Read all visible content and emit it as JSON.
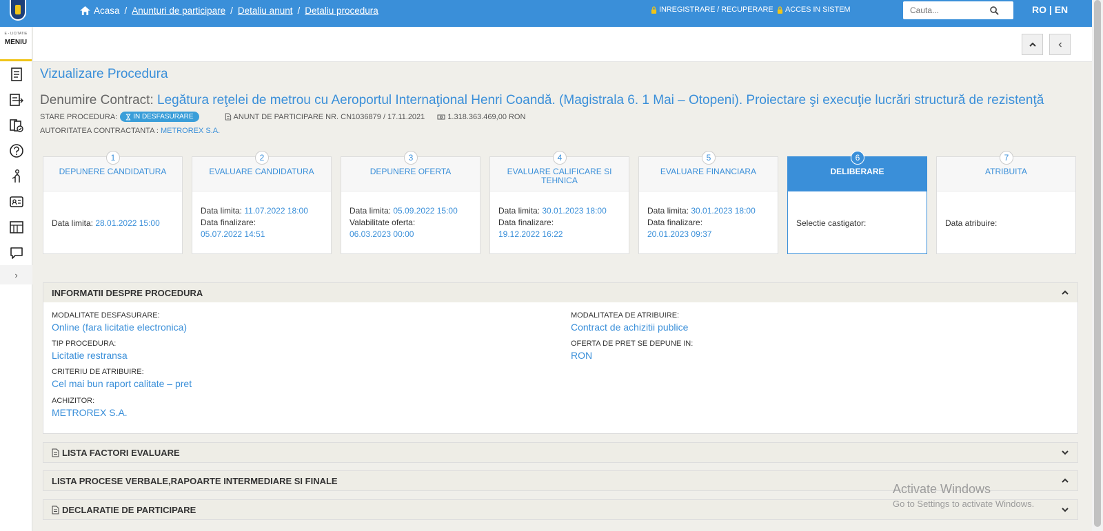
{
  "topbar": {
    "breadcrumbs": [
      "Acasa",
      "Anunturi de participare",
      "Detaliu anunt",
      "Detaliu procedura"
    ],
    "register_label": "INREGISTRARE / RECUPERARE",
    "login_label": "ACCES IN SISTEM",
    "search_placeholder": "Cauta...",
    "language": "RO | EN"
  },
  "sidebar": {
    "brand_small": "E - LICITATIE",
    "menu_label": "MENIU",
    "items": [
      "procedures-icon",
      "export-icon",
      "documents-check-icon",
      "help-icon",
      "user-handshake-icon",
      "id-card-icon",
      "catalog-icon",
      "chat-icon"
    ]
  },
  "header": {
    "title": "Vizualizare Procedura",
    "contract_label": "Denumire Contract:",
    "contract_name": "Legătura reţelei de metrou cu Aeroportul Internaţional Henri Coandă. (Magistrala 6. 1 Mai – Otopeni). Proiectare şi execuţie lucrări structură de rezistenţă",
    "status_label": "STARE PROCEDURA:",
    "status_value": "IN DESFASURARE",
    "notice": "ANUNT DE PARTICIPARE NR. CN1036879 / 17.11.2021",
    "value": "1.318.363.469,00  RON",
    "authority_label": "AUTORITATEA CONTRACTANTA :",
    "authority_value": "METROREX S.A."
  },
  "steps": [
    {
      "num": "1",
      "title": "DEPUNERE CANDIDATURA",
      "l1": "Data limita: ",
      "v1": "28.01.2022 15:00",
      "l2": "",
      "v2": ""
    },
    {
      "num": "2",
      "title": "EVALUARE CANDIDATURA",
      "l1": "Data limita: ",
      "v1": "11.07.2022 18:00",
      "l2": "Data finalizare:",
      "v2": "05.07.2022 14:51"
    },
    {
      "num": "3",
      "title": "DEPUNERE OFERTA",
      "l1": "Data limita: ",
      "v1": "05.09.2022 15:00",
      "l2": "Valabilitate oferta:",
      "v2": "06.03.2023 00:00"
    },
    {
      "num": "4",
      "title": "EVALUARE CALIFICARE SI TEHNICA",
      "l1": "Data limita: ",
      "v1": "30.01.2023 18:00",
      "l2": "Data finalizare:",
      "v2": "19.12.2022 16:22"
    },
    {
      "num": "5",
      "title": "EVALUARE FINANCIARA",
      "l1": "Data limita: ",
      "v1": "30.01.2023 18:00",
      "l2": "Data finalizare:",
      "v2": "20.01.2023 09:37"
    },
    {
      "num": "6",
      "title": "DELIBERARE",
      "l1": "Selectie castigator:",
      "v1": "",
      "l2": "",
      "v2": ""
    },
    {
      "num": "7",
      "title": "ATRIBUITA",
      "l1": "Data atribuire:",
      "v1": "",
      "l2": "",
      "v2": ""
    }
  ],
  "info_panel": {
    "title": "INFORMATII DESPRE PROCEDURA",
    "fields": [
      {
        "label": "MODALITATE DESFASURARE:",
        "value": "Online (fara licitatie electronica)"
      },
      {
        "label": "TIP PROCEDURA:",
        "value": "Licitatie restransa"
      },
      {
        "label": "CRITERIU DE ATRIBUIRE:",
        "value": "Cel mai bun raport calitate – pret"
      },
      {
        "label": "ACHIZITOR:",
        "value": "METROREX S.A."
      },
      {
        "label": "MODALITATEA DE ATRIBUIRE:",
        "value": "Contract de achizitii publice"
      },
      {
        "label": "OFERTA DE PRET SE DEPUNE IN:",
        "value": "RON"
      }
    ]
  },
  "sections": [
    {
      "title": "LISTA FACTORI EVALUARE"
    },
    {
      "title": "LISTA PROCESE VERBALE,RAPOARTE INTERMEDIARE SI FINALE"
    },
    {
      "title": "DECLARATIE DE PARTICIPARE"
    }
  ],
  "watermark": {
    "line1": "Activate Windows",
    "line2": "Go to Settings to activate Windows."
  }
}
